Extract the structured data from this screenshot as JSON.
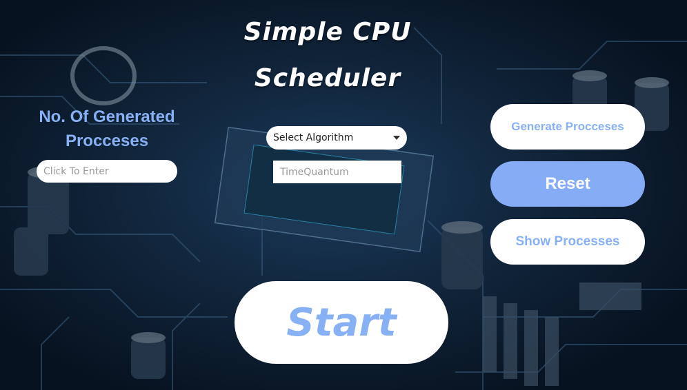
{
  "app": {
    "title_line1": "Simple CPU",
    "title_line2": "Scheduler"
  },
  "generated": {
    "label": "No. Of Generated Procceses",
    "input_placeholder": "Click To Enter",
    "input_value": ""
  },
  "algorithm": {
    "selected": "Select Algorithm",
    "time_quantum_placeholder": "TimeQuantum"
  },
  "buttons": {
    "generate": "Generate Procceses",
    "reset": "Reset",
    "show": "Show Processes",
    "start": "Start"
  },
  "colors": {
    "accent": "#86acf5",
    "background": "#0b1a2c"
  },
  "icons": {
    "select_caret": "chevron-down-icon"
  }
}
